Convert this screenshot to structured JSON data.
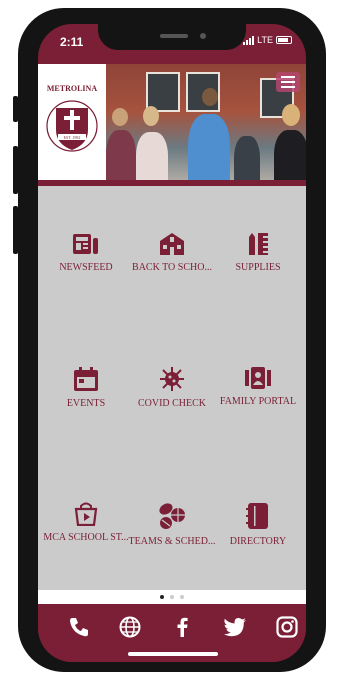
{
  "status": {
    "time": "2:11",
    "network": "LTE"
  },
  "header": {
    "logo_name": "METROLINA",
    "logo_est": "EST. 1982"
  },
  "tiles": [
    {
      "label": "NEWSFEED",
      "icon": "newspaper-icon"
    },
    {
      "label": "BACK TO SCHO...",
      "icon": "school-building-icon"
    },
    {
      "label": "SUPPLIES",
      "icon": "pencil-ruler-icon"
    },
    {
      "label": "EVENTS",
      "icon": "calendar-icon"
    },
    {
      "label": "COVID CHECK",
      "icon": "virus-icon"
    },
    {
      "label": "FAMILY PORTAL",
      "icon": "id-card-icon"
    },
    {
      "label": "MCA SCHOOL ST...",
      "icon": "shopping-bag-icon"
    },
    {
      "label": "TEAMS & SCHED...",
      "icon": "sports-balls-icon"
    },
    {
      "label": "DIRECTORY",
      "icon": "address-book-icon"
    }
  ],
  "pagination": {
    "pages": 3,
    "current": 1
  },
  "social": [
    "phone-icon",
    "globe-icon",
    "facebook-icon",
    "twitter-icon",
    "instagram-icon"
  ],
  "colors": {
    "brand": "#7a1f36",
    "content_bg": "#cbcbcb"
  }
}
